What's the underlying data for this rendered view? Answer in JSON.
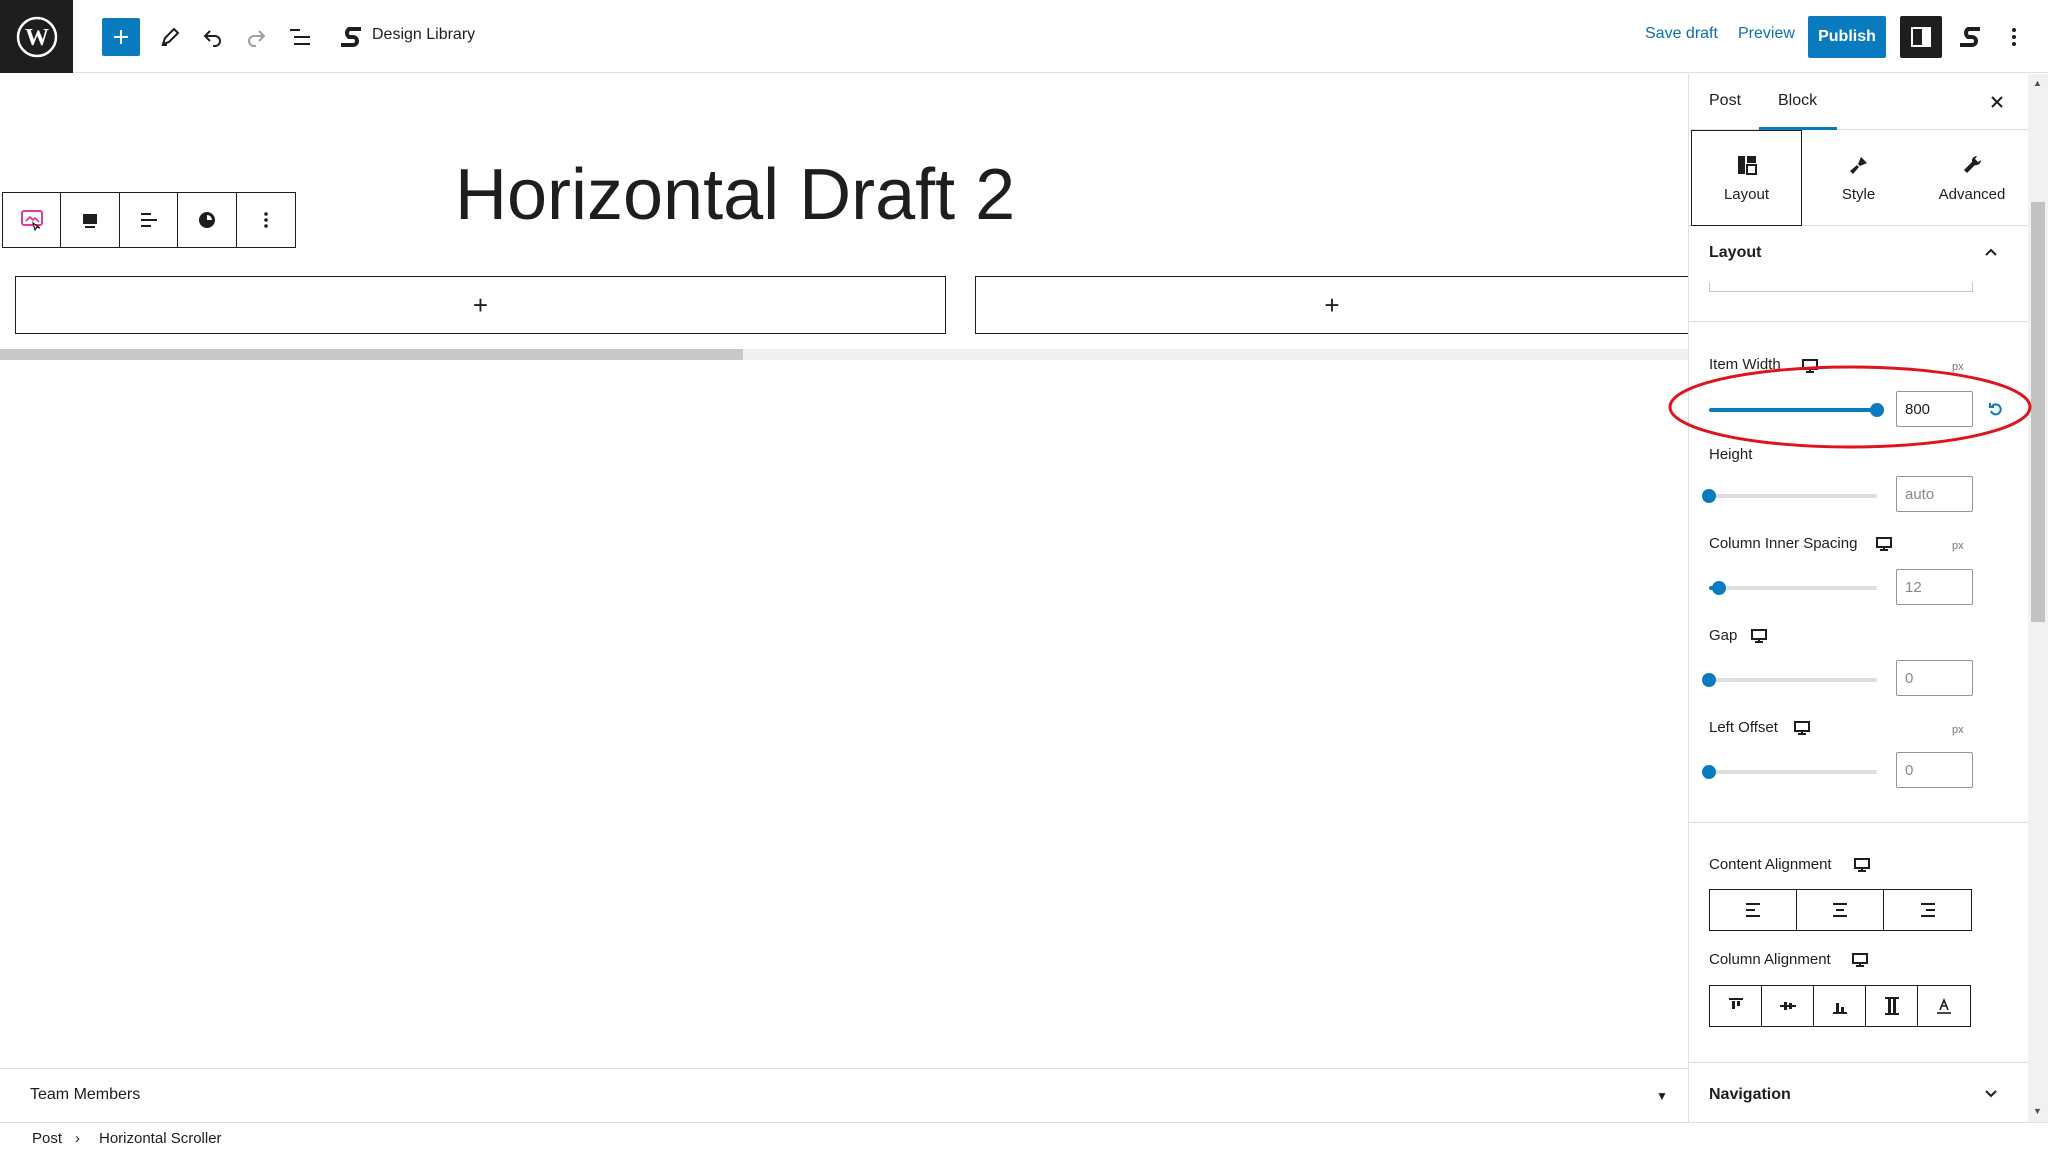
{
  "topbar": {
    "design_library_label": "Design Library",
    "save_draft": "Save draft",
    "preview": "Preview",
    "publish": "Publish"
  },
  "canvas": {
    "post_title": "Horizontal Draft 2",
    "appender_symbol": "+",
    "scroll_progress": 0.44
  },
  "bottom_panel": {
    "label": "Team Members"
  },
  "breadcrumb": {
    "items": [
      "Post",
      "Horizontal Scroller"
    ]
  },
  "sidebar": {
    "tabs": [
      "Post",
      "Block"
    ],
    "active_tab": "Block",
    "sub_tabs": [
      {
        "label": "Layout",
        "icon": "layout-icon"
      },
      {
        "label": "Style",
        "icon": "brush-icon"
      },
      {
        "label": "Advanced",
        "icon": "wrench-icon"
      }
    ],
    "active_sub_tab": "Layout",
    "layout_section": {
      "title": "Layout",
      "item_width": {
        "label": "Item Width",
        "unit": "px",
        "value": "800",
        "level": 1.0
      },
      "height": {
        "label": "Height",
        "placeholder": "auto",
        "level": 0.0
      },
      "column_inner_spacing": {
        "label": "Column Inner Spacing",
        "unit": "px",
        "placeholder": "12",
        "level": 0.06
      },
      "gap": {
        "label": "Gap",
        "placeholder": "0",
        "level": 0.0
      },
      "left_offset": {
        "label": "Left Offset",
        "unit": "px",
        "placeholder": "0",
        "level": 0.0
      },
      "content_alignment": {
        "label": "Content Alignment",
        "options": [
          "align-left-icon",
          "align-center-icon",
          "align-right-icon"
        ]
      },
      "column_alignment": {
        "label": "Column Alignment",
        "options": [
          "align-top-icon",
          "align-middle-icon",
          "align-bottom-icon",
          "stretch-icon",
          "baseline-icon"
        ]
      }
    },
    "navigation_section": {
      "title": "Navigation"
    }
  },
  "colors": {
    "accent": "#0a7bbf",
    "annotation": "#e0141e",
    "dark": "#1e1e1e"
  }
}
